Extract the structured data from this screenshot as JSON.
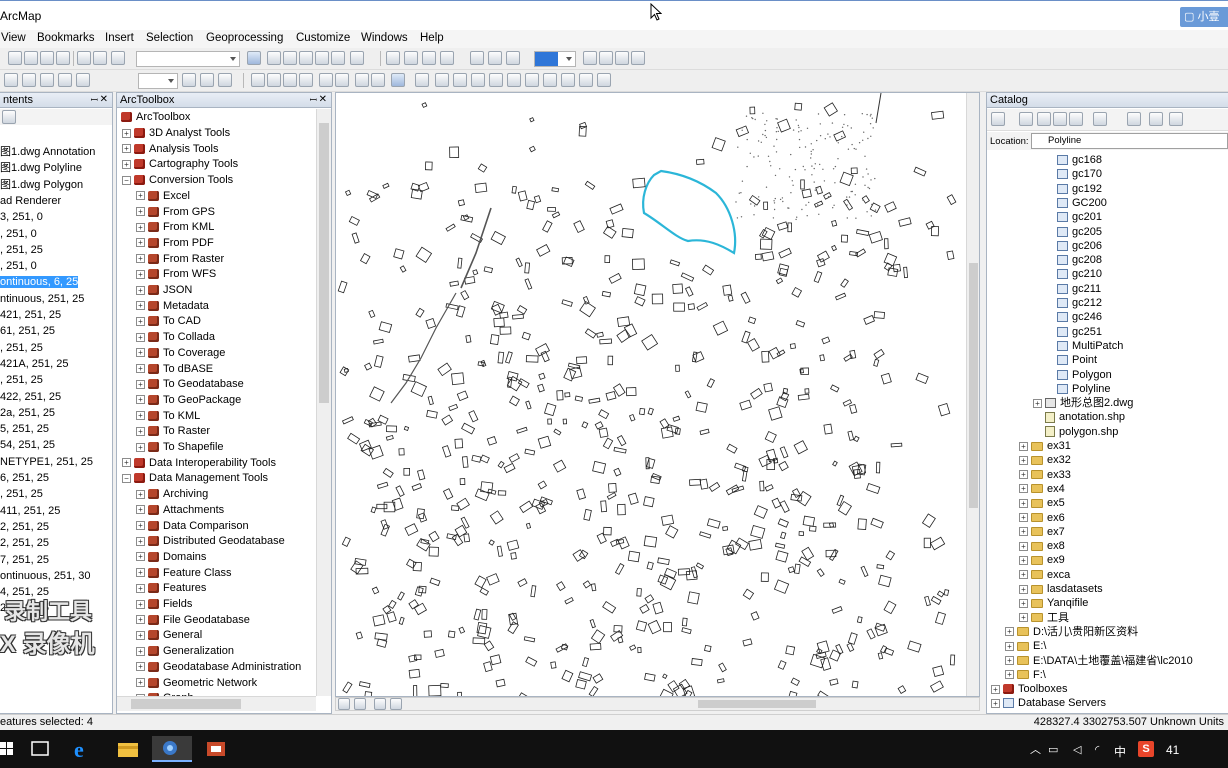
{
  "title_bar": {
    "title": "ArcMap",
    "badge": "小壹"
  },
  "menu": {
    "items": [
      "View",
      "Bookmarks",
      "Insert",
      "Selection",
      "Geoprocessing",
      "Customize",
      "Windows",
      "Help"
    ]
  },
  "toc": {
    "header": "ntents",
    "rows": [
      "图1.dwg Annotation",
      "图1.dwg Polyline",
      "图1.dwg Polygon",
      "ad Renderer",
      "3, 251, 0",
      ", 251, 0",
      ", 251, 25",
      ", 251, 0",
      "ontinuous, 6, 25",
      "ntinuous, 251, 25",
      "421, 251, 25",
      "61, 251, 25",
      ", 251, 25",
      "421A, 251, 25",
      ", 251, 25",
      "422, 251, 25",
      "2a, 251, 25",
      "5, 251, 25",
      "54, 251, 25",
      "NETYPE1, 251, 25",
      "6, 251, 25",
      ", 251, 25",
      "411, 251, 25",
      "2, 251, 25",
      "2, 251, 25",
      "7, 251, 25",
      "ontinuous, 251, 30",
      "4, 251, 25",
      "2, 251, 25"
    ],
    "selected_row": "ontinuous, 6, 25"
  },
  "arctoolbox": {
    "header": "ArcToolbox",
    "root": "ArcToolbox",
    "items": [
      {
        "label": "3D Analyst Tools",
        "level": 0,
        "expanded": false
      },
      {
        "label": "Analysis Tools",
        "level": 0,
        "expanded": false
      },
      {
        "label": "Cartography Tools",
        "level": 0,
        "expanded": false
      },
      {
        "label": "Conversion Tools",
        "level": 0,
        "expanded": true
      },
      {
        "label": "Excel",
        "level": 1,
        "expanded": false
      },
      {
        "label": "From GPS",
        "level": 1,
        "expanded": false
      },
      {
        "label": "From KML",
        "level": 1,
        "expanded": false
      },
      {
        "label": "From PDF",
        "level": 1,
        "expanded": false
      },
      {
        "label": "From Raster",
        "level": 1,
        "expanded": false
      },
      {
        "label": "From WFS",
        "level": 1,
        "expanded": false
      },
      {
        "label": "JSON",
        "level": 1,
        "expanded": false
      },
      {
        "label": "Metadata",
        "level": 1,
        "expanded": false
      },
      {
        "label": "To CAD",
        "level": 1,
        "expanded": false
      },
      {
        "label": "To Collada",
        "level": 1,
        "expanded": false
      },
      {
        "label": "To Coverage",
        "level": 1,
        "expanded": false
      },
      {
        "label": "To dBASE",
        "level": 1,
        "expanded": false
      },
      {
        "label": "To Geodatabase",
        "level": 1,
        "expanded": false
      },
      {
        "label": "To GeoPackage",
        "level": 1,
        "expanded": false
      },
      {
        "label": "To KML",
        "level": 1,
        "expanded": false
      },
      {
        "label": "To Raster",
        "level": 1,
        "expanded": false
      },
      {
        "label": "To Shapefile",
        "level": 1,
        "expanded": false
      },
      {
        "label": "Data Interoperability Tools",
        "level": 0,
        "expanded": false
      },
      {
        "label": "Data Management Tools",
        "level": 0,
        "expanded": true
      },
      {
        "label": "Archiving",
        "level": 1,
        "expanded": false
      },
      {
        "label": "Attachments",
        "level": 1,
        "expanded": false
      },
      {
        "label": "Data Comparison",
        "level": 1,
        "expanded": false
      },
      {
        "label": "Distributed Geodatabase",
        "level": 1,
        "expanded": false
      },
      {
        "label": "Domains",
        "level": 1,
        "expanded": false
      },
      {
        "label": "Feature Class",
        "level": 1,
        "expanded": false
      },
      {
        "label": "Features",
        "level": 1,
        "expanded": false
      },
      {
        "label": "Fields",
        "level": 1,
        "expanded": false
      },
      {
        "label": "File Geodatabase",
        "level": 1,
        "expanded": false
      },
      {
        "label": "General",
        "level": 1,
        "expanded": false
      },
      {
        "label": "Generalization",
        "level": 1,
        "expanded": false
      },
      {
        "label": "Geodatabase Administration",
        "level": 1,
        "expanded": false
      },
      {
        "label": "Geometric Network",
        "level": 1,
        "expanded": false
      },
      {
        "label": "Graph",
        "level": 1,
        "expanded": false
      }
    ]
  },
  "catalog": {
    "header": "Catalog",
    "location_label": "Location:",
    "location_value": "Polyline",
    "items": [
      {
        "label": "gc168",
        "icon": "cad-feature"
      },
      {
        "label": "gc170",
        "icon": "cad-feature"
      },
      {
        "label": "gc192",
        "icon": "cad-feature"
      },
      {
        "label": "GC200",
        "icon": "cad-feature"
      },
      {
        "label": "gc201",
        "icon": "cad-feature"
      },
      {
        "label": "gc205",
        "icon": "cad-feature"
      },
      {
        "label": "gc206",
        "icon": "cad-feature"
      },
      {
        "label": "gc208",
        "icon": "cad-feature"
      },
      {
        "label": "gc210",
        "icon": "cad-feature"
      },
      {
        "label": "gc211",
        "icon": "cad-feature"
      },
      {
        "label": "gc212",
        "icon": "cad-feature"
      },
      {
        "label": "gc246",
        "icon": "cad-feature"
      },
      {
        "label": "gc251",
        "icon": "cad-feature"
      },
      {
        "label": "MultiPatch",
        "icon": "cad-feature"
      },
      {
        "label": "Point",
        "icon": "cad-feature"
      },
      {
        "label": "Polygon",
        "icon": "cad-feature"
      },
      {
        "label": "Polyline",
        "icon": "cad-feature"
      },
      {
        "label": "地形总图2.dwg",
        "icon": "cad-drawing"
      },
      {
        "label": "anotation.shp",
        "icon": "shapefile"
      },
      {
        "label": "polygon.shp",
        "icon": "shapefile"
      },
      {
        "label": "ex31",
        "icon": "folder"
      },
      {
        "label": "ex32",
        "icon": "folder"
      },
      {
        "label": "ex33",
        "icon": "folder"
      },
      {
        "label": "ex4",
        "icon": "folder"
      },
      {
        "label": "ex5",
        "icon": "folder"
      },
      {
        "label": "ex6",
        "icon": "folder"
      },
      {
        "label": "ex7",
        "icon": "folder"
      },
      {
        "label": "ex8",
        "icon": "folder"
      },
      {
        "label": "ex9",
        "icon": "folder"
      },
      {
        "label": "exca",
        "icon": "folder"
      },
      {
        "label": "lasdatasets",
        "icon": "folder"
      },
      {
        "label": "Yanqifile",
        "icon": "folder"
      },
      {
        "label": "工具",
        "icon": "folder"
      },
      {
        "label": "D:\\活儿\\贵阳新区资料",
        "icon": "folder"
      },
      {
        "label": "E:\\",
        "icon": "folder"
      },
      {
        "label": "E:\\DATA\\土地覆盖\\福建省\\lc2010",
        "icon": "folder"
      },
      {
        "label": "F:\\",
        "icon": "folder"
      },
      {
        "label": "Toolboxes",
        "icon": "toolbox"
      },
      {
        "label": "Database Servers",
        "icon": "server"
      }
    ]
  },
  "status": {
    "features_selected": "eatures selected: 4",
    "coords": "428327.4  3302753.507 Unknown Units"
  },
  "taskbar": {
    "lang": "中",
    "ime": "S",
    "clock": "41"
  },
  "watermark": {
    "line1": "录制工具",
    "line2": "X 录像机"
  },
  "colors": {
    "selection_outline": "#2bb6d8",
    "selected_row": "#3399ff"
  }
}
